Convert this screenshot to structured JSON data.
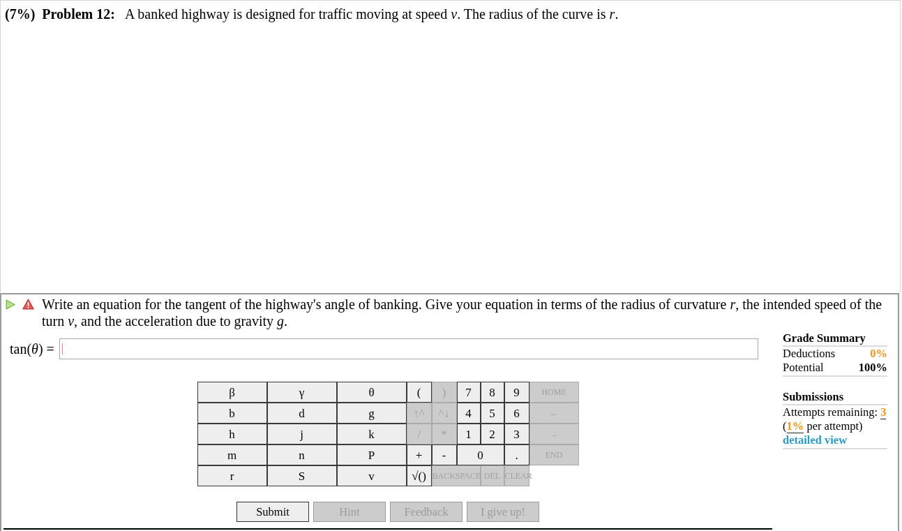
{
  "problem": {
    "weight": "(7%)",
    "title": "Problem 12:",
    "statement": "A banked highway is designed for traffic moving at speed *v*. The radius of the curve is *r*."
  },
  "part": {
    "prompt": "Write an equation for the tangent of the highway's angle of banking. Give your equation in terms of the radius of curvature *r*, the intended speed of the turn *v*, and the acceleration due to gravity *g*.",
    "answer": {
      "label": "tan(*θ*) =",
      "focused": true
    },
    "keypad": {
      "rows": [
        [
          {
            "label": "β",
            "kind": "variable",
            "disabled": false
          },
          {
            "label": "γ",
            "kind": "variable",
            "disabled": false
          },
          {
            "label": "θ",
            "kind": "variable",
            "disabled": false
          },
          {
            "label": "(",
            "kind": "symbol",
            "disabled": false
          },
          {
            "label": ")",
            "kind": "symbol",
            "disabled": true
          },
          {
            "label": "7",
            "kind": "symbol",
            "disabled": false
          },
          {
            "label": "8",
            "kind": "symbol",
            "disabled": false
          },
          {
            "label": "9",
            "kind": "symbol",
            "disabled": false
          },
          {
            "label": "HOME",
            "kind": "command",
            "disabled": true
          }
        ],
        [
          {
            "label": "b",
            "kind": "variable",
            "disabled": false
          },
          {
            "label": "d",
            "kind": "variable",
            "disabled": false
          },
          {
            "label": "g",
            "kind": "variable",
            "disabled": false
          },
          {
            "label": "↑^",
            "kind": "symbol",
            "disabled": true
          },
          {
            "label": "^↓",
            "kind": "symbol",
            "disabled": true
          },
          {
            "label": "4",
            "kind": "symbol",
            "disabled": false
          },
          {
            "label": "5",
            "kind": "symbol",
            "disabled": false
          },
          {
            "label": "6",
            "kind": "symbol",
            "disabled": false
          },
          {
            "label": "←",
            "kind": "command",
            "disabled": true
          }
        ],
        [
          {
            "label": "h",
            "kind": "variable",
            "disabled": false
          },
          {
            "label": "j",
            "kind": "variable",
            "disabled": false
          },
          {
            "label": "k",
            "kind": "variable",
            "disabled": false
          },
          {
            "label": "/",
            "kind": "symbol",
            "disabled": true
          },
          {
            "label": "*",
            "kind": "symbol",
            "disabled": true
          },
          {
            "label": "1",
            "kind": "symbol",
            "disabled": false
          },
          {
            "label": "2",
            "kind": "symbol",
            "disabled": false
          },
          {
            "label": "3",
            "kind": "symbol",
            "disabled": false
          },
          {
            "label": "→",
            "kind": "command",
            "disabled": true
          }
        ],
        [
          {
            "label": "m",
            "kind": "variable",
            "disabled": false
          },
          {
            "label": "n",
            "kind": "variable",
            "disabled": false
          },
          {
            "label": "P",
            "kind": "variable",
            "disabled": false
          },
          {
            "label": "+",
            "kind": "symbol",
            "disabled": false
          },
          {
            "label": "-",
            "kind": "symbol",
            "disabled": false
          },
          {
            "label": "0",
            "kind": "wide",
            "disabled": false
          },
          "",
          {
            "label": ".",
            "kind": "symbol",
            "disabled": false
          },
          {
            "label": "END",
            "kind": "command",
            "disabled": true
          }
        ],
        [
          {
            "label": "r",
            "kind": "variable",
            "disabled": false
          },
          {
            "label": "S",
            "kind": "variable",
            "disabled": false
          },
          {
            "label": "v",
            "kind": "variable",
            "disabled": false
          },
          {
            "label": "√()",
            "kind": "symbol",
            "disabled": false
          },
          {
            "label": "BACKSPACE",
            "kind": "long",
            "disabled": true
          },
          "",
          {
            "label": "DEL",
            "kind": "command",
            "disabled": true
          },
          {
            "label": "CLEAR",
            "kind": "command",
            "disabled": true
          }
        ]
      ]
    },
    "buttons": [
      {
        "label": "Submit",
        "disabled": false
      },
      {
        "label": "Hint",
        "disabled": true
      },
      {
        "label": "Feedback",
        "disabled": true
      },
      {
        "label": "I give up!",
        "disabled": true
      }
    ]
  },
  "grade_summary": {
    "title": "Grade Summary",
    "deductions": {
      "label": "Deductions",
      "value": "0%"
    },
    "potential": {
      "label": "Potential",
      "value": "100%"
    }
  },
  "submissions": {
    "title": "Submissions",
    "attempts": "Attempts remaining: **3**",
    "penalty": "(**1%** per attempt)",
    "link": "detailed view"
  }
}
